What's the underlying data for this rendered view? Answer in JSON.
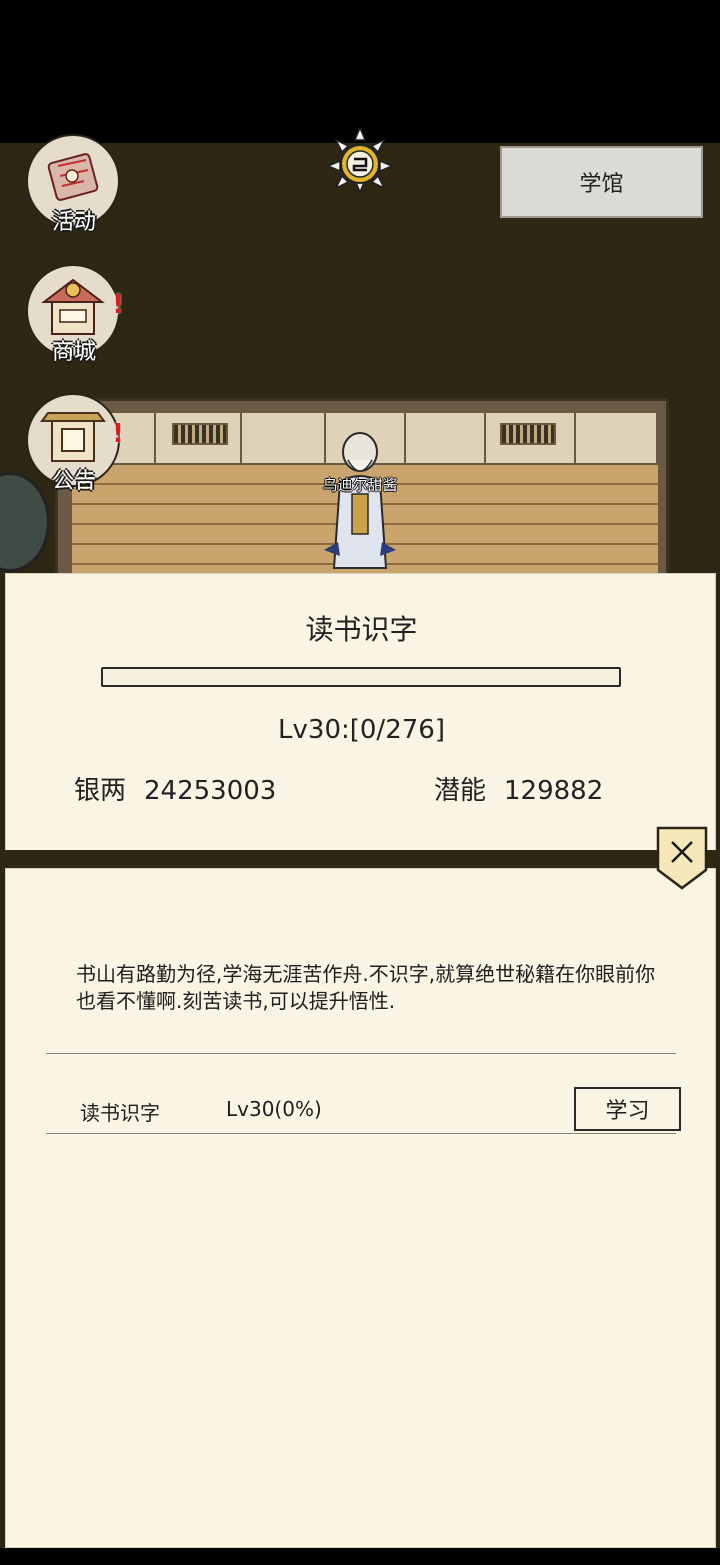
{
  "header": {
    "location_button": "学馆"
  },
  "side_menu": {
    "items": [
      {
        "label": "活动",
        "icon": "scroll-icon"
      },
      {
        "label": "商城",
        "icon": "shop-icon",
        "badge": "!"
      },
      {
        "label": "公告",
        "icon": "notice-icon",
        "badge": "!"
      }
    ]
  },
  "npc": {
    "name": "乌迪尔甜酱"
  },
  "panel": {
    "title": "读书识字",
    "progress": 0,
    "level_text": "Lv30:[0/276]",
    "silver_label": "银两",
    "silver_value": "24253003",
    "potential_label": "潜能",
    "potential_value": "129882"
  },
  "detail": {
    "description": "书山有路勤为径,学海无涯苦作舟.不识字,就算绝世秘籍在你眼前你也看不懂啊.刻苦读书,可以提升悟性.",
    "skill_name": "读书识字",
    "skill_level": "Lv30(0%)",
    "learn_label": "学习"
  },
  "colors": {
    "panel_bg": "#faf4e4",
    "scene_bg": "#2d2713",
    "badge": "#d62020"
  }
}
